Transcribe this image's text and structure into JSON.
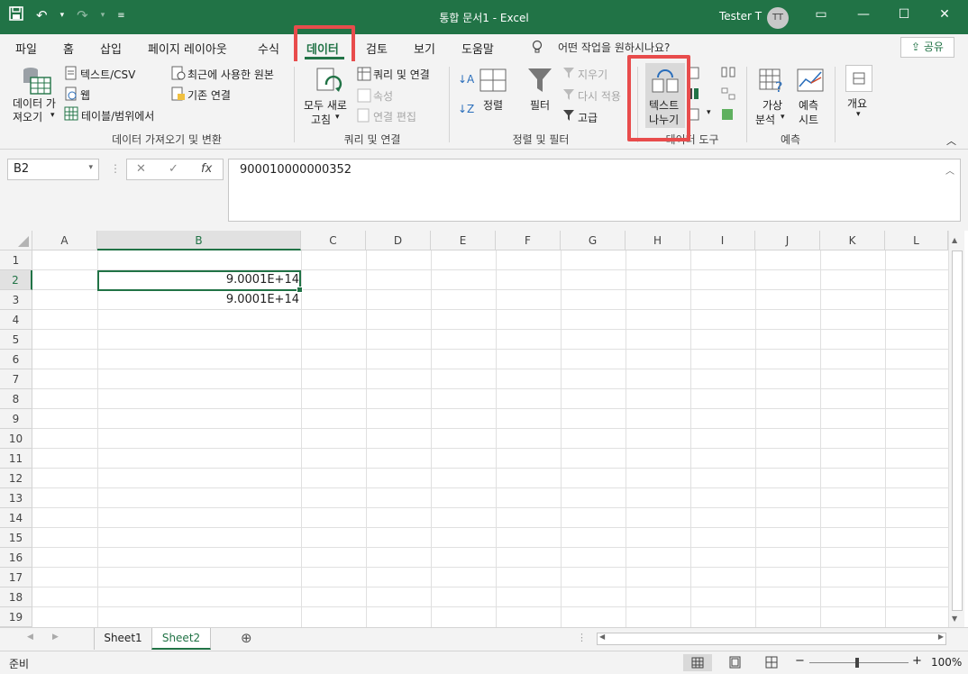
{
  "titlebar": {
    "title": "통합 문서1  -  Excel",
    "user": "Tester T",
    "avatar": "TT",
    "qat": [
      "save-icon",
      "undo-icon",
      "redo-icon",
      "customize-qat-icon"
    ],
    "window_buttons": [
      "ribbon-display-options-icon",
      "minimize-icon",
      "restore-icon",
      "close-icon"
    ]
  },
  "tabs": {
    "items": [
      "파일",
      "홈",
      "삽입",
      "페이지 레이아웃",
      "수식",
      "데이터",
      "검토",
      "보기",
      "도움말"
    ],
    "active": "데이터",
    "tell_me": "어떤 작업을 원하시나요?",
    "share": "공유"
  },
  "ribbon": {
    "get_transform": {
      "label": "데이터 가져오기 및 변환",
      "get_data": "데이터 가\n져오기",
      "text_csv": "텍스트/CSV",
      "web": "웹",
      "table_range": "테이블/범위에서",
      "recent_sources": "최근에 사용한 원본",
      "existing_connections": "기존 연결"
    },
    "queries": {
      "label": "쿼리 및 연결",
      "refresh_all_1": "모두 새로",
      "refresh_all_2": "고침",
      "queries_connections": "쿼리 및 연결",
      "properties": "속성",
      "edit_links": "연결 편집"
    },
    "sort_filter": {
      "label": "정렬 및 필터",
      "sort": "정렬",
      "filter": "필터",
      "clear": "지우기",
      "reapply": "다시 적용",
      "advanced": "고급"
    },
    "data_tools": {
      "label": "데이터 도구",
      "text_to_columns_1": "텍스트",
      "text_to_columns_2": "나누기"
    },
    "forecast": {
      "label": "예측",
      "what_if_1": "가상",
      "what_if_2": "분석",
      "forecast_sheet_1": "예측",
      "forecast_sheet_2": "시트"
    },
    "outline": {
      "label": "개요"
    }
  },
  "formula_bar": {
    "name_box": "B2",
    "value": "900010000000352",
    "fx": "fx"
  },
  "grid": {
    "columns": [
      "A",
      "B",
      "C",
      "D",
      "E",
      "F",
      "G",
      "H",
      "I",
      "J",
      "K",
      "L"
    ],
    "rows": [
      "1",
      "2",
      "3",
      "4",
      "5",
      "6",
      "7",
      "8",
      "9",
      "10",
      "11",
      "12",
      "13",
      "14",
      "15",
      "16",
      "17",
      "18",
      "19"
    ],
    "selected_cell": "B2",
    "cells": {
      "B2": "9.0001E+14",
      "B3": "9.0001E+14"
    }
  },
  "sheets": {
    "tabs": [
      "Sheet1",
      "Sheet2"
    ],
    "active": "Sheet2"
  },
  "status": {
    "ready": "준비",
    "zoom": "100%"
  },
  "highlights": {
    "color": "#e84c4c",
    "targets": [
      "tab-data",
      "text-to-columns-button"
    ]
  },
  "colors": {
    "accent": "#217346"
  }
}
